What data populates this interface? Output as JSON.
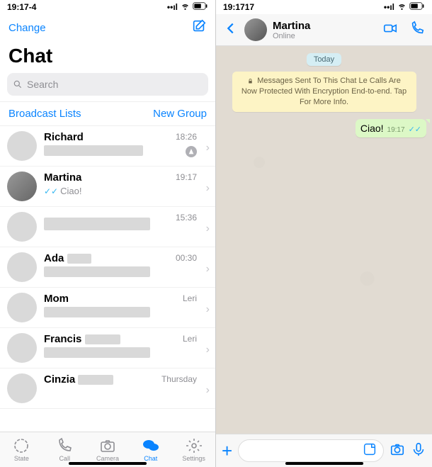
{
  "status": {
    "time_left": "19:17-4",
    "time_right": "19:1717"
  },
  "left": {
    "change": "Change",
    "title": "Chat",
    "search_placeholder": "Search",
    "broadcast": "Broadcast Lists",
    "new_group": "New Group",
    "chats": [
      {
        "name": "Richard",
        "time": "18:26",
        "preview": "",
        "muted": true
      },
      {
        "name": "Martina",
        "time": "19:17",
        "preview": "Ciao!",
        "ticks": true
      },
      {
        "name": "",
        "time": "15:36",
        "preview": ""
      },
      {
        "name": "Ada",
        "time": "00:30",
        "preview": ""
      },
      {
        "name": "Mom",
        "time": "Leri",
        "preview": ""
      },
      {
        "name": "Francis",
        "time": "Leri",
        "preview": ""
      },
      {
        "name": "Cinzia",
        "time": "Thursday",
        "preview": ""
      }
    ],
    "tabs": {
      "state": "State",
      "call": "Call",
      "camera": "Camera",
      "chat": "Chat",
      "settings": "Settings"
    }
  },
  "right": {
    "contact": {
      "name": "Martina",
      "status": "Online"
    },
    "date_label": "Today",
    "encryption": "Messages Sent To This Chat Le Calls Are Now Protected With Encryption End-to-end. Tap For More Info.",
    "message": {
      "text": "Ciao!",
      "time": "19:17"
    }
  }
}
